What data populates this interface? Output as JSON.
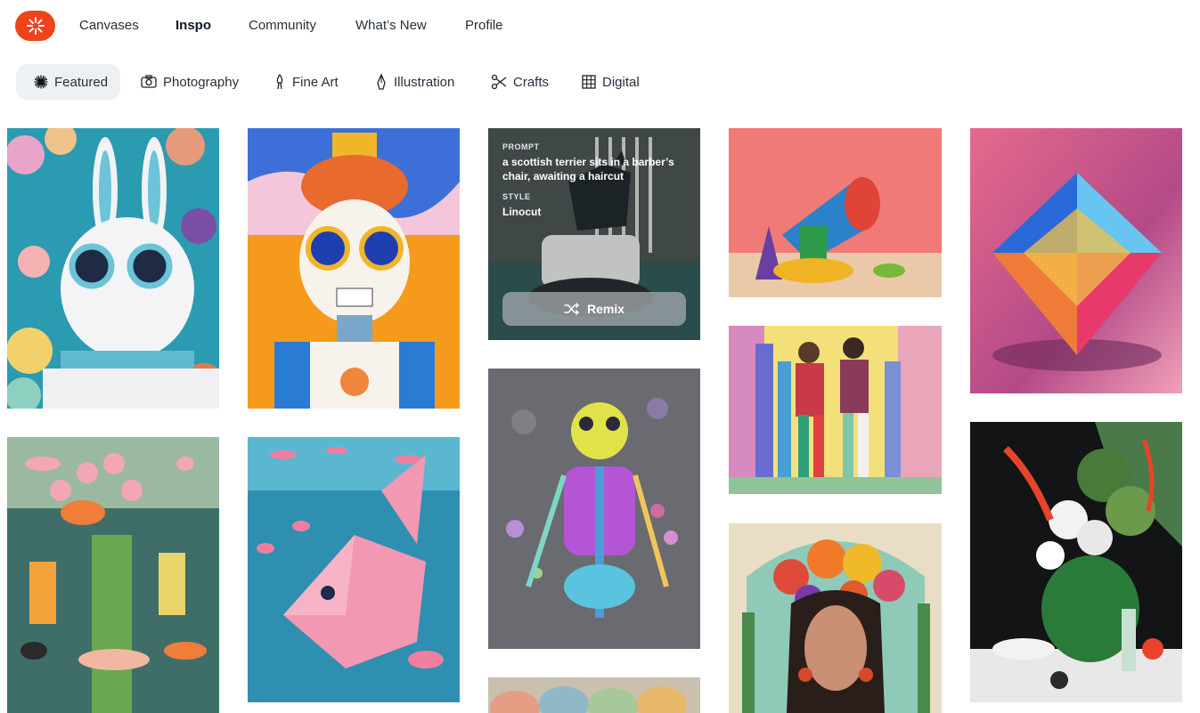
{
  "nav": {
    "links": [
      "Canvases",
      "Inspo",
      "Community",
      "What’s New",
      "Profile"
    ],
    "active": "Inspo"
  },
  "categories": {
    "items": [
      "Featured",
      "Photography",
      "Fine Art",
      "Illustration",
      "Crafts",
      "Digital"
    ],
    "icons": [
      "sparkle-icon",
      "camera-icon",
      "brush-icon",
      "pen-nib-icon",
      "scissors-icon",
      "grid-icon"
    ],
    "active": "Featured"
  },
  "gallery": {
    "hover_card": {
      "prompt_label": "PROMPT",
      "prompt_text": "a scottish terrier sits in a barber’s chair, awaiting a haircut",
      "style_label": "STYLE",
      "style_value": "Linocut",
      "remix_label": "Remix"
    },
    "images": [
      "white-rabbit-with-goggles",
      "fish-and-flowers-collage",
      "sugar-skull-robot",
      "low-poly-pink-fish",
      "scottish-terrier-linocut",
      "rainbow-skeleton",
      "easter-eggs",
      "megaphone-sculpture",
      "fashion-couple-illustration",
      "woman-flower-crown",
      "crystal-diamond",
      "flower-arrangement-still-life"
    ]
  },
  "colors": {
    "brand": "#f0431c",
    "chip_active_bg": "#eef1f4"
  }
}
